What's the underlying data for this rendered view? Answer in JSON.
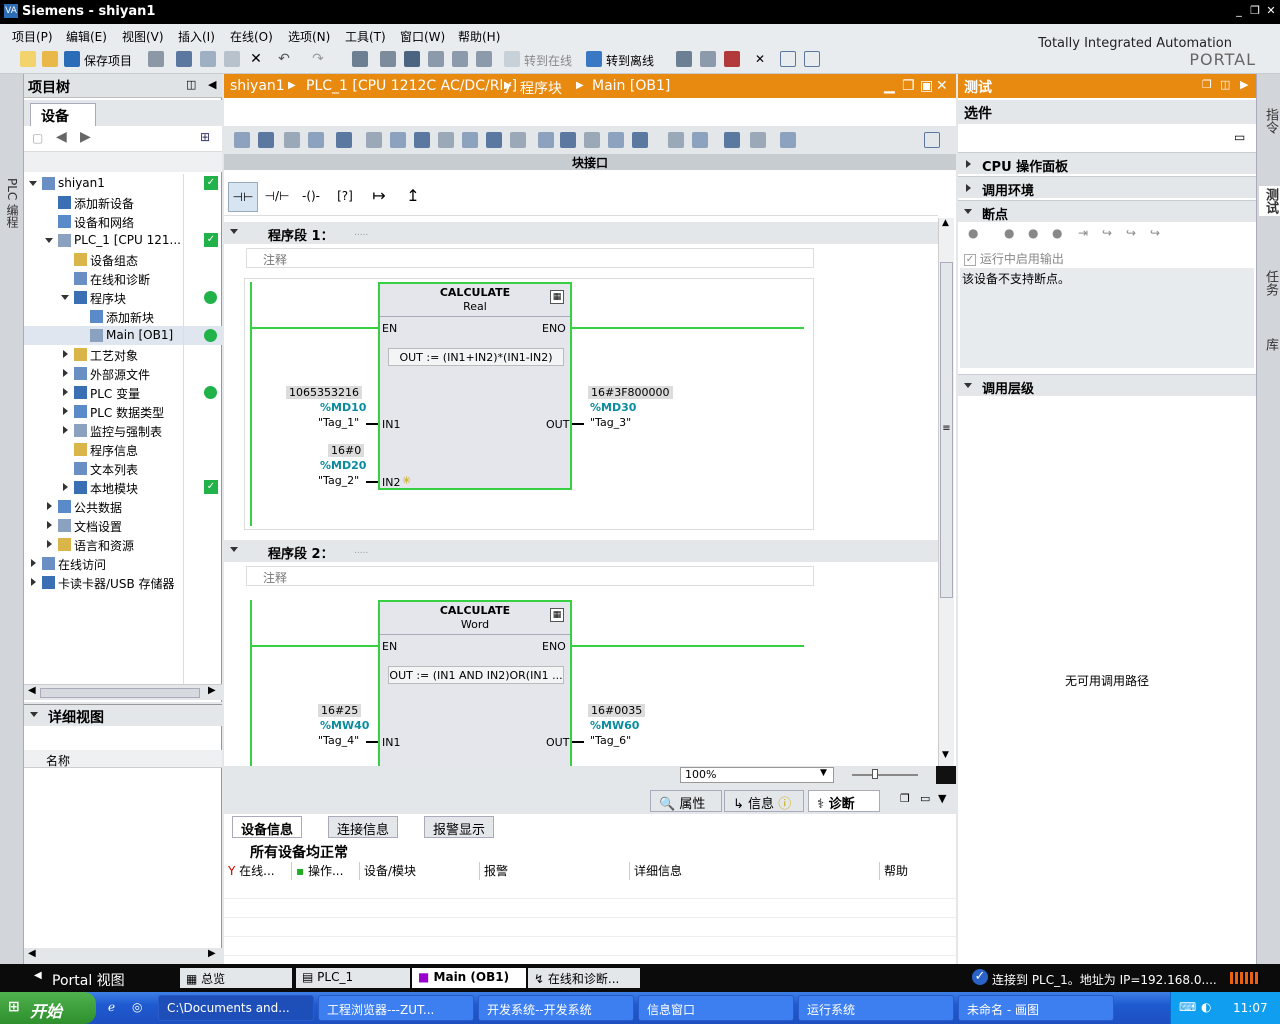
{
  "window": {
    "title": "Siemens  -  shiyan1"
  },
  "menu": [
    "项目(P)",
    "编辑(E)",
    "视图(V)",
    "插入(I)",
    "在线(O)",
    "选项(N)",
    "工具(T)",
    "窗口(W)",
    "帮助(H)"
  ],
  "toolbar": {
    "save": "保存项目",
    "go_online": "转到在线",
    "go_offline": "转到离线"
  },
  "brand": {
    "line1": "Totally Integrated Automation",
    "line2": "PORTAL"
  },
  "left_sidebar": {
    "label": "PLC 编程"
  },
  "project_tree": {
    "title": "项目树",
    "tab": "设备",
    "items": [
      {
        "label": "shiyan1",
        "level": 0,
        "state": "open",
        "status": "check"
      },
      {
        "label": "添加新设备",
        "level": 1,
        "state": "none",
        "status": ""
      },
      {
        "label": "设备和网络",
        "level": 1,
        "state": "none",
        "status": ""
      },
      {
        "label": "PLC_1 [CPU 121...",
        "level": 1,
        "state": "open",
        "status": "check"
      },
      {
        "label": "设备组态",
        "level": 2,
        "state": "none",
        "status": ""
      },
      {
        "label": "在线和诊断",
        "level": 2,
        "state": "none",
        "status": ""
      },
      {
        "label": "程序块",
        "level": 2,
        "state": "open",
        "status": "dot"
      },
      {
        "label": "添加新块",
        "level": 3,
        "state": "none",
        "status": ""
      },
      {
        "label": "Main [OB1]",
        "level": 3,
        "state": "none",
        "status": "dot"
      },
      {
        "label": "工艺对象",
        "level": 2,
        "state": "closed",
        "status": ""
      },
      {
        "label": "外部源文件",
        "level": 2,
        "state": "closed",
        "status": ""
      },
      {
        "label": "PLC 变量",
        "level": 2,
        "state": "closed",
        "status": "dot"
      },
      {
        "label": "PLC 数据类型",
        "level": 2,
        "state": "closed",
        "status": ""
      },
      {
        "label": "监控与强制表",
        "level": 2,
        "state": "closed",
        "status": ""
      },
      {
        "label": "程序信息",
        "level": 2,
        "state": "none",
        "status": ""
      },
      {
        "label": "文本列表",
        "level": 2,
        "state": "none",
        "status": ""
      },
      {
        "label": "本地模块",
        "level": 2,
        "state": "closed",
        "status": "check"
      },
      {
        "label": "公共数据",
        "level": 1,
        "state": "closed",
        "status": ""
      },
      {
        "label": "文档设置",
        "level": 1,
        "state": "closed",
        "status": ""
      },
      {
        "label": "语言和资源",
        "level": 1,
        "state": "closed",
        "status": ""
      },
      {
        "label": "在线访问",
        "level": 0,
        "state": "closed",
        "status": ""
      },
      {
        "label": "卡读卡器/USB 存储器",
        "level": 0,
        "state": "closed",
        "status": ""
      }
    ]
  },
  "detail_view": {
    "title": "详细视图",
    "column": "名称"
  },
  "editor": {
    "breadcrumb": [
      "shiyan1",
      "PLC_1 [CPU 1212C AC/DC/Rly]",
      "程序块",
      "Main [OB1]"
    ],
    "block_interface": "块接口",
    "zoom": "100%",
    "networks": [
      {
        "title": "程序段 1：",
        "dots": ".....",
        "comment": "注释",
        "block_name": "CALCULATE",
        "block_type": "Real",
        "en": "EN",
        "eno": "ENO",
        "formula": "OUT :=   (IN1+IN2)*(IN1-IN2)",
        "in1": {
          "pin": "IN1",
          "value": "1065353216",
          "addr": "%MD10",
          "tag": "\"Tag_1\""
        },
        "in2": {
          "pin": "IN2",
          "value": "16#0",
          "addr": "%MD20",
          "tag": "\"Tag_2\""
        },
        "out": {
          "pin": "OUT",
          "value": "16#3F800000",
          "addr": "%MD30",
          "tag": "\"Tag_3\""
        }
      },
      {
        "title": "程序段 2：",
        "dots": ".....",
        "comment": "注释",
        "block_name": "CALCULATE",
        "block_type": "Word",
        "en": "EN",
        "eno": "ENO",
        "formula": "OUT :=   (IN1 AND IN2)OR(IN1 ...",
        "in1": {
          "pin": "IN1",
          "value": "16#25",
          "addr": "%MW40",
          "tag": "\"Tag_4\""
        },
        "out": {
          "pin": "OUT",
          "value": "16#0035",
          "addr": "%MW60",
          "tag": "\"Tag_6\""
        }
      }
    ]
  },
  "test_panel": {
    "title": "测试",
    "options": "选件",
    "cpu_panel": "CPU 操作面板",
    "call_env": "调用环境",
    "breakpoints": "断点",
    "enable_output": "运行中启用输出",
    "no_bp_msg": "该设备不支持断点。",
    "call_hierarchy": "调用层级",
    "no_path": "无可用调用路径"
  },
  "right_sidebar": [
    "指令",
    "测试",
    "任务",
    "库"
  ],
  "inspector": {
    "tabs": [
      "属性",
      "信息",
      "诊断"
    ],
    "subtabs": [
      "设备信息",
      "连接信息",
      "报警显示"
    ],
    "status": "所有设备均正常",
    "columns": [
      "在线...",
      "操作...",
      "设备/模块",
      "报警",
      "详细信息",
      "帮助"
    ]
  },
  "statusbar": {
    "portal_view": "Portal 视图",
    "tabs": [
      "总览",
      "PLC_1",
      "Main (OB1)",
      "在线和诊断..."
    ],
    "connection": "连接到 PLC_1。地址为 IP=192.168.0...."
  },
  "taskbar": {
    "start": "开始",
    "tasks": [
      "C:\\Documents and...",
      "工程浏览器---ZUT...",
      "开发系统--开发系统",
      "信息窗口",
      "运行系统",
      "未命名 - 画图"
    ],
    "time": "11:07"
  }
}
